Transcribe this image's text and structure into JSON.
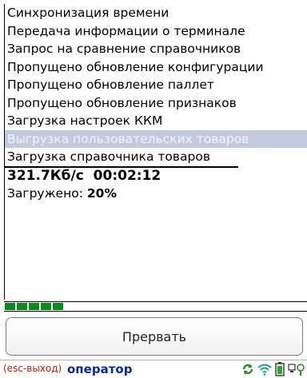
{
  "log": {
    "items": [
      "Синхронизация времени",
      "Передача информации о терминале",
      "Запрос на сравнение справочников",
      "Пропущено обновление конфигурации",
      "Пропущено обновление паллет",
      "Пропущено обновление признаков",
      "Загрузка настроек ККМ",
      "Выгрузка пользовательских товаров",
      "Загрузка справочника товаров"
    ],
    "selected_index": 7,
    "speed": "321.7Кб/с",
    "elapsed": "00:02:12",
    "loaded_label": "Загружено:",
    "loaded_value": "20%"
  },
  "progress": {
    "fraction": 0.2
  },
  "buttons": {
    "abort_label": "Прервать"
  },
  "status": {
    "hint": "(esc-выход)",
    "user": "оператор",
    "icons": [
      "sync-icon",
      "wifi-icon",
      "battery-icon",
      "network-icon"
    ]
  },
  "colors": {
    "progress": "#0b8a1c",
    "selection": "#c3cadf",
    "hint": "#b0200f",
    "user": "#0a2a9a"
  }
}
